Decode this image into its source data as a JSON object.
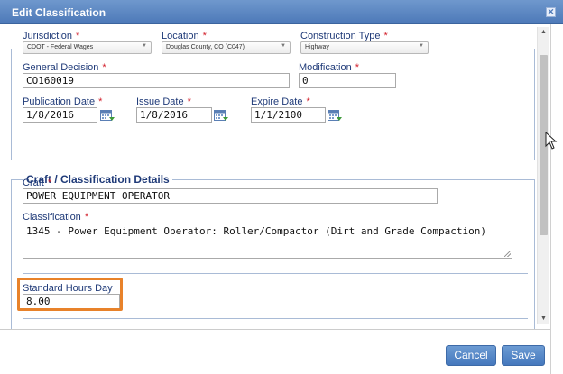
{
  "dialog": {
    "title": "Edit Classification"
  },
  "icons": {
    "close": "close-icon",
    "calendar": "calendar-icon",
    "dropdown": "chevron-down-icon"
  },
  "colors": {
    "title_bar": "#4d79b8",
    "label": "#1f3a78",
    "required": "#d21f2b",
    "button": "#4578bd",
    "highlight": "#e8822a"
  },
  "form": {
    "jurisdiction": {
      "label": "Jurisdiction",
      "value": "CDOT - Federal Wages"
    },
    "location": {
      "label": "Location",
      "value": "Douglas County, CO (C047)"
    },
    "construction_type": {
      "label": "Construction Type",
      "value": "Highway"
    },
    "general_decision": {
      "label": "General Decision",
      "value": "CO160019"
    },
    "modification": {
      "label": "Modification",
      "value": "0"
    },
    "publication_date": {
      "label": "Publication Date",
      "value": "1/8/2016"
    },
    "issue_date": {
      "label": "Issue Date",
      "value": "1/8/2016"
    },
    "expire_date": {
      "label": "Expire Date",
      "value": "1/1/2100"
    }
  },
  "craft_section": {
    "legend": "Craft / Classification Details",
    "craft": {
      "label": "Craft",
      "value": "POWER EQUIPMENT OPERATOR"
    },
    "classification": {
      "label": "Classification",
      "value": "1345 - Power Equipment Operator: Roller/Compactor (Dirt and Grade Compaction)"
    },
    "standard_hours": {
      "label": "Standard Hours Day",
      "value": "8.00"
    }
  },
  "required_mark": "*",
  "buttons": {
    "cancel": "Cancel",
    "save": "Save"
  }
}
